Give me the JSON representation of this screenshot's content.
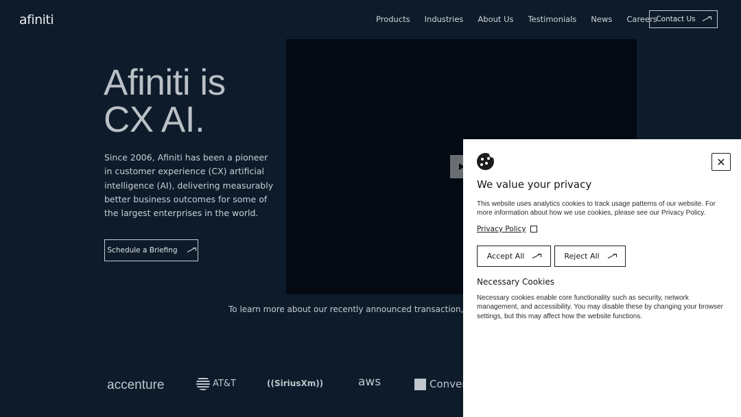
{
  "header": {
    "logo": "afiniti",
    "nav": [
      "Products",
      "Industries",
      "About Us",
      "Testimonials",
      "News",
      "Careers"
    ],
    "contact_label": "Contact Us"
  },
  "hero": {
    "title_line1": "Afiniti is",
    "title_line2": "CX AI.",
    "description": "Since 2006, Afiniti has been a pioneer in customer experience (CX) artificial intelligence (AI), delivering measurably better business outcomes for some of the largest enterprises in the world.",
    "briefing_label": "Schedule a Briefing"
  },
  "transaction_text": "To learn more about our recently announced transaction, please",
  "clients": {
    "accenture": "accenture",
    "att": "AT&T",
    "sirius": "((SiriusXm))",
    "aws": "aws",
    "conversant": "Conver"
  },
  "cookie": {
    "title": "We value your privacy",
    "text": "This website uses analytics cookies to track usage patterns of our website. For more information about how we use cookies, please see our Privacy Policy.",
    "policy_link": "Privacy Policy",
    "accept_label": "Accept All",
    "reject_label": "Reject All",
    "necessary_title": "Necessary Cookies",
    "necessary_text": "Necessary cookies enable core functionality such as security, network management, and accessibility. You may disable these by changing your browser settings, but this may affect how the website functions.",
    "close_symbol": "✕"
  }
}
